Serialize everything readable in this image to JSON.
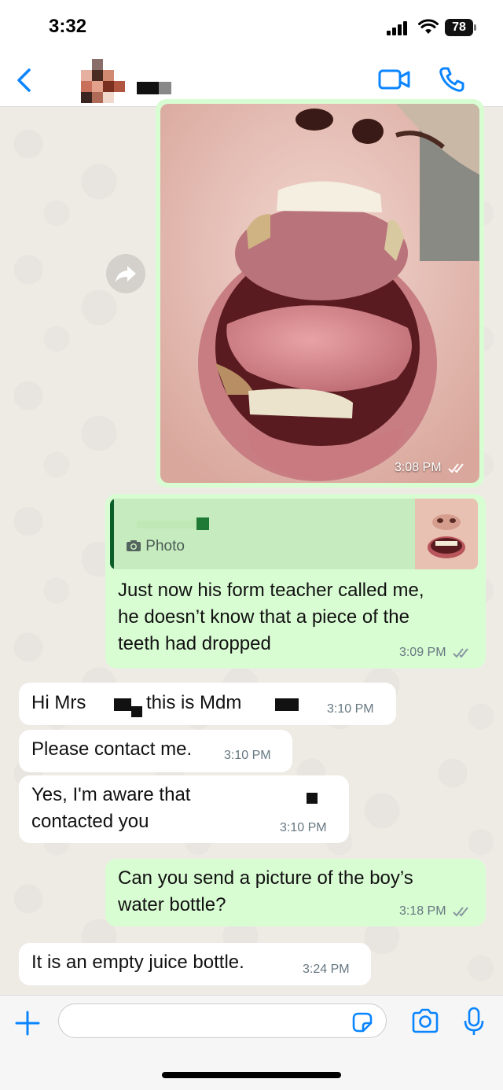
{
  "status_bar": {
    "time": "3:32",
    "battery": "78"
  },
  "header": {
    "icons": [
      "back-icon",
      "video-call-icon",
      "voice-call-icon"
    ]
  },
  "messages": [
    {
      "direction": "out",
      "type": "photo",
      "time": "3:08 PM",
      "status": "read"
    },
    {
      "direction": "out",
      "type": "reply",
      "quote_label": "Photo",
      "text": "Just now his form teacher called me, he doesn’t know that a piece of the teeth had dropped",
      "line1": "Just now his form teacher called me,",
      "line2": "he doesn’t know that a piece of the",
      "line3": "teeth had dropped",
      "time": "3:09 PM",
      "status": "read"
    },
    {
      "direction": "in",
      "text_a": "Hi Mrs",
      "text_b": "this is Mdm",
      "time": "3:10 PM"
    },
    {
      "direction": "in",
      "text": "Please contact me.",
      "time": "3:10 PM"
    },
    {
      "direction": "in",
      "line1": "Yes, I'm aware that",
      "line2": "contacted you",
      "time": "3:10 PM"
    },
    {
      "direction": "out",
      "line1": "Can you send a picture of the boy’s",
      "line2": "water bottle?",
      "time": "3:18 PM",
      "status": "read"
    },
    {
      "direction": "in",
      "text": "It is an empty juice bottle.",
      "time": "3:24 PM"
    }
  ],
  "input": {
    "placeholder": "",
    "icons": [
      "plus-icon",
      "sticker-icon",
      "camera-icon",
      "mic-icon"
    ]
  },
  "colors": {
    "accent": "#0a84ff",
    "outgoing_bubble": "#d9fdd3",
    "incoming_bubble": "#ffffff",
    "read_ticks": "#8696a0"
  }
}
